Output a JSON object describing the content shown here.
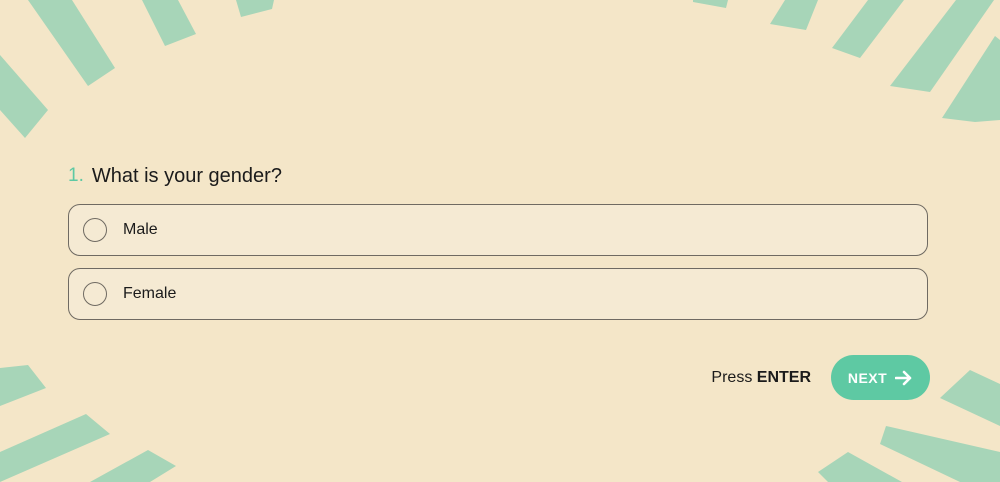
{
  "theme": {
    "background": "#f4e6c8",
    "accent": "#5ec9a3",
    "stripe": "#a7d5b8",
    "option_fill": "#f5ead3",
    "border": "#6f6a62"
  },
  "question": {
    "number": "1.",
    "text": "What is your gender?"
  },
  "options": [
    {
      "label": "Male",
      "selected": false
    },
    {
      "label": "Female",
      "selected": false
    }
  ],
  "footer": {
    "press_prefix": "Press",
    "press_key": "ENTER",
    "next_label": "NEXT",
    "next_icon": "arrow-right-icon"
  },
  "background_art": {
    "icon": "radiating-stripes-decoration"
  }
}
